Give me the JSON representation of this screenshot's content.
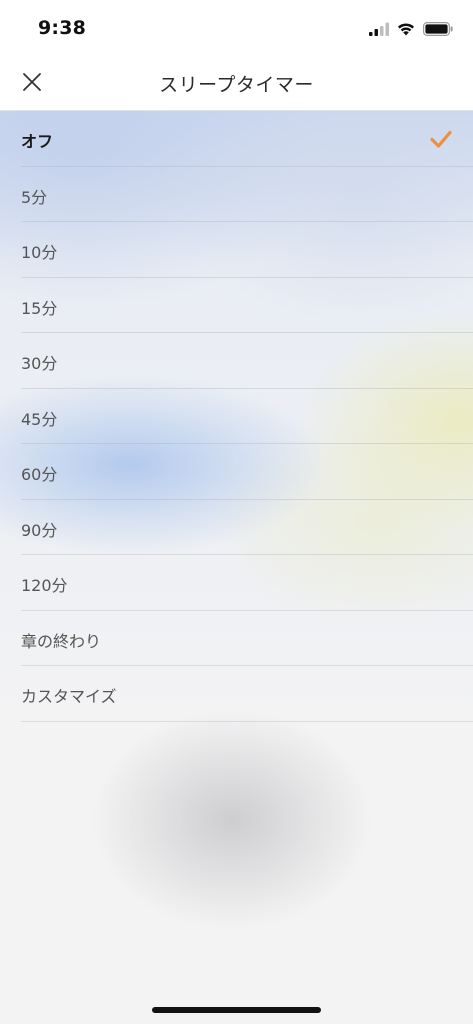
{
  "status_bar": {
    "time": "9:38"
  },
  "header": {
    "title": "スリープタイマー",
    "close_icon": "close-icon"
  },
  "options": [
    {
      "label": "オフ",
      "selected": true
    },
    {
      "label": "5分",
      "selected": false
    },
    {
      "label": "10分",
      "selected": false
    },
    {
      "label": "15分",
      "selected": false
    },
    {
      "label": "30分",
      "selected": false
    },
    {
      "label": "45分",
      "selected": false
    },
    {
      "label": "60分",
      "selected": false
    },
    {
      "label": "90分",
      "selected": false
    },
    {
      "label": "120分",
      "selected": false
    },
    {
      "label": "章の終わり",
      "selected": false
    },
    {
      "label": "カスタマイズ",
      "selected": false
    }
  ],
  "colors": {
    "accent_check": "#ee8f3d",
    "header_background": "#ffffff"
  }
}
